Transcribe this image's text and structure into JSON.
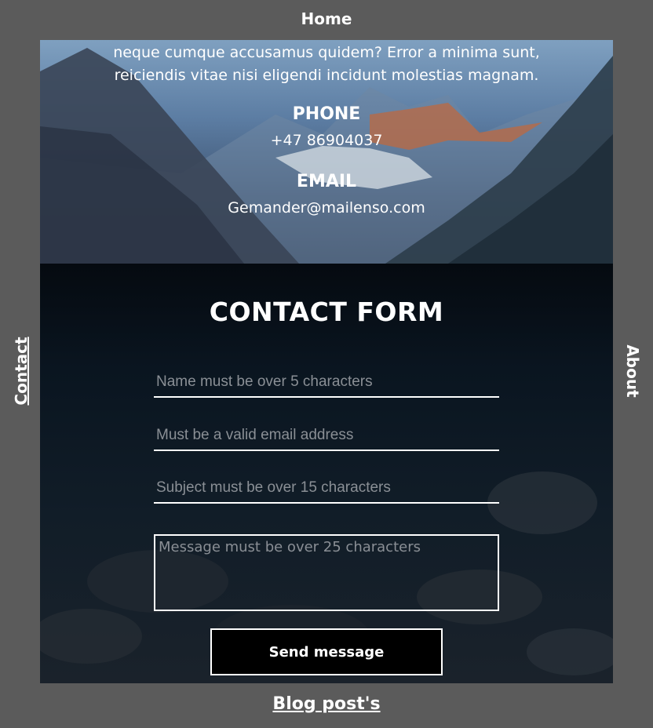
{
  "nav": {
    "home": "Home",
    "contact": "Contact",
    "about": "About",
    "blog": "Blog post's"
  },
  "intro": {
    "line1": "neque cumque accusamus quidem? Error a minima sunt,",
    "line2": "reiciendis vitae nisi eligendi incidunt molestias magnam."
  },
  "contact_info": {
    "phone_heading": "PHONE",
    "phone_value": "+47 86904037",
    "email_heading": "EMAIL",
    "email_value": "Gemander@mailenso.com"
  },
  "form": {
    "title": "CONTACT FORM",
    "name_placeholder": "Name must be over 5 characters",
    "email_placeholder": "Must be a valid email address",
    "subject_placeholder": "Subject must be over 15 characters",
    "message_placeholder": "Message must be over 25 characters",
    "submit_label": "Send message"
  },
  "colors": {
    "page_background": "#5b5b5b",
    "text": "#ffffff",
    "button_background": "#000000"
  }
}
